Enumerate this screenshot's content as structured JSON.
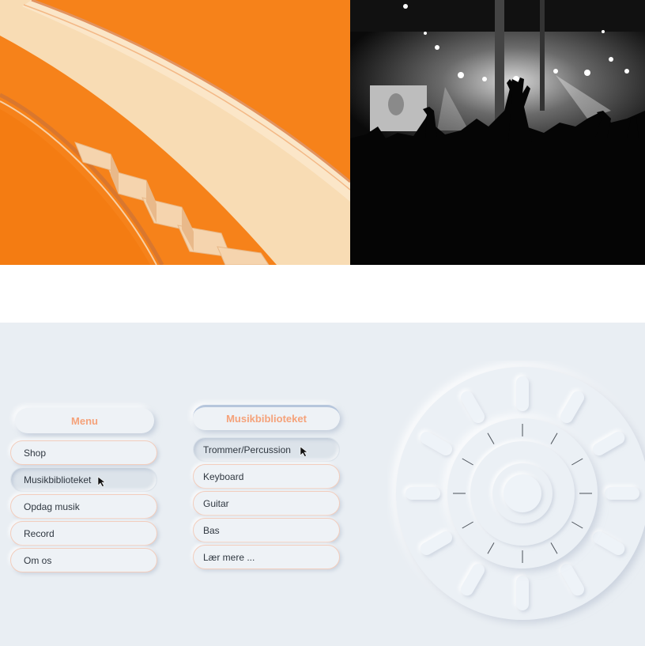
{
  "menu": {
    "title": "Menu",
    "items": [
      {
        "label": "Shop"
      },
      {
        "label": "Musikbiblioteket",
        "active": true
      },
      {
        "label": "Opdag musik"
      },
      {
        "label": "Record"
      },
      {
        "label": "Om os"
      }
    ]
  },
  "library": {
    "title": "Musikbiblioteket",
    "items": [
      {
        "label": "Trommer/Percussion",
        "active": true
      },
      {
        "label": "Keyboard"
      },
      {
        "label": "Guitar"
      },
      {
        "label": "Bas"
      },
      {
        "label": "Lær mere ..."
      }
    ]
  },
  "colors": {
    "accent_orange": "#f57c14",
    "header_text": "#f5a27a",
    "panel_bg": "#e9eef3"
  },
  "icons": [
    "cursor-arrow-icon",
    "cursor-arrow-icon"
  ]
}
